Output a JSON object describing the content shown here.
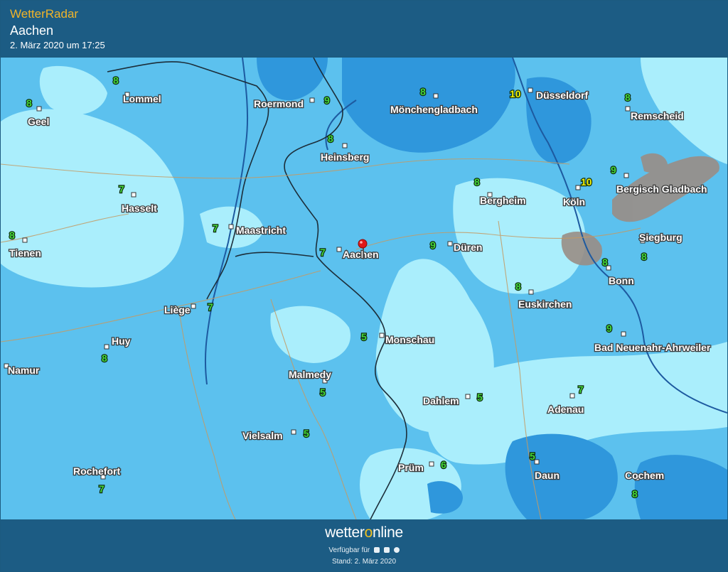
{
  "header": {
    "brand": "WetterRadar",
    "location": "Aachen",
    "timestamp": "2. März 2020 um 17:25"
  },
  "colors": {
    "header_bg": "#1c5c84",
    "brand": "#f0b429",
    "precip_light": "#aaeefc",
    "precip_medium": "#5cc1ee",
    "precip_heavy": "#2f97dc",
    "mixed_precip": "#9a8e86",
    "temp_normal": "#45d63a",
    "temp_high": "#f2f20a",
    "location_marker": "#e01818"
  },
  "map": {
    "marker": {
      "name": "Aachen",
      "icon": "location-pin-icon"
    },
    "cities": [
      {
        "name": "Lommel",
        "temp": "8"
      },
      {
        "name": "Geel",
        "temp": "8"
      },
      {
        "name": "Roermond",
        "temp": "9"
      },
      {
        "name": "Mönchengladbach",
        "temp": "8"
      },
      {
        "name": "Düsseldorf",
        "temp": "10"
      },
      {
        "name": "Remscheid",
        "temp": "8"
      },
      {
        "name": "Heinsberg",
        "temp": "8"
      },
      {
        "name": "Hasselt",
        "temp": "7"
      },
      {
        "name": "Bergheim",
        "temp": "8"
      },
      {
        "name": "Köln",
        "temp": "10"
      },
      {
        "name": "Bergisch Gladbach",
        "temp": "9"
      },
      {
        "name": "Tienen",
        "temp": "8"
      },
      {
        "name": "Maastricht",
        "temp": "7"
      },
      {
        "name": "Aachen",
        "temp": "7"
      },
      {
        "name": "Düren",
        "temp": "9"
      },
      {
        "name": "Siegburg",
        "temp": "8"
      },
      {
        "name": "Bonn",
        "temp": "8"
      },
      {
        "name": "Liège",
        "temp": "7"
      },
      {
        "name": "Euskirchen",
        "temp": "8"
      },
      {
        "name": "Monschau",
        "temp": "5"
      },
      {
        "name": "Huy",
        "temp": "8"
      },
      {
        "name": "Bad Neuenahr-Ahrweiler",
        "temp": "9"
      },
      {
        "name": "Namur",
        "temp": ""
      },
      {
        "name": "Malmedy",
        "temp": "5"
      },
      {
        "name": "Dahlem",
        "temp": "5"
      },
      {
        "name": "Adenau",
        "temp": "7"
      },
      {
        "name": "Vielsalm",
        "temp": "5"
      },
      {
        "name": "Prüm",
        "temp": "6"
      },
      {
        "name": "Daun",
        "temp": "5"
      },
      {
        "name": "Rochefort",
        "temp": "7"
      },
      {
        "name": "Cochem",
        "temp": "8"
      }
    ]
  },
  "footer": {
    "logo_prefix": "wetter",
    "logo_o": "o",
    "logo_suffix": "nline",
    "available": "Verfügbar für",
    "platform_icons": [
      "android-icon",
      "apple-icon",
      "web-icon"
    ],
    "stand": "Stand: 2. März 2020"
  }
}
